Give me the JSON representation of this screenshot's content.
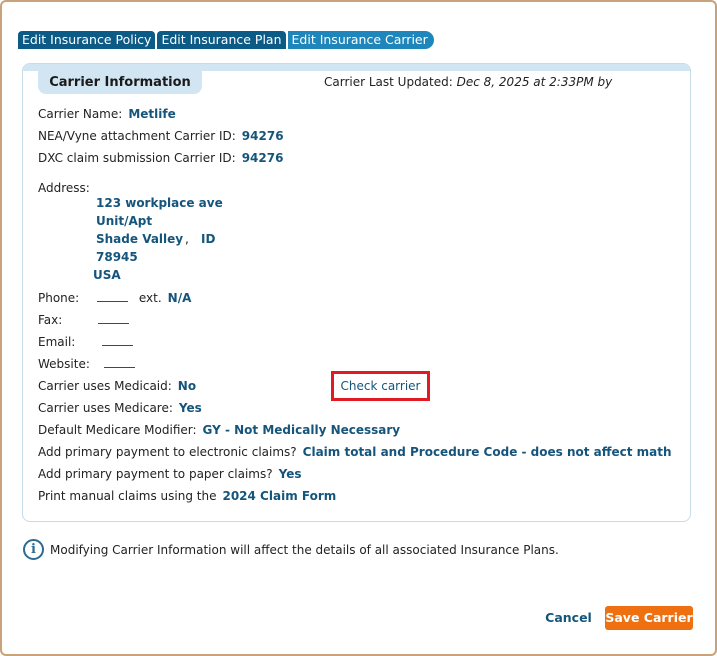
{
  "tabs": [
    {
      "label": "Edit Insurance Policy"
    },
    {
      "label": "Edit Insurance Plan"
    },
    {
      "label": "Edit Insurance Carrier"
    }
  ],
  "section_title": "Carrier Information",
  "last_updated": {
    "label": "Carrier Last Updated:",
    "when": "Dec 8, 2025 at 2:33PM by"
  },
  "fields": {
    "carrier_name": {
      "label": "Carrier Name:",
      "value": "Metlife"
    },
    "nea_id": {
      "label": "NEA/Vyne attachment Carrier ID:",
      "value": "94276"
    },
    "dxc_id": {
      "label": "DXC claim submission Carrier ID:",
      "value": "94276"
    },
    "address_label": "Address:",
    "address": {
      "street": "123 workplace ave",
      "unit": "Unit/Apt",
      "city": "Shade Valley",
      "comma": ",",
      "state": "ID",
      "zip": "78945",
      "country": "USA"
    },
    "phone": {
      "label": "Phone:",
      "ext_label": "ext.",
      "ext_value": "N/A"
    },
    "fax": {
      "label": "Fax:"
    },
    "email": {
      "label": "Email:"
    },
    "website": {
      "label": "Website:"
    },
    "medicaid": {
      "label": "Carrier uses Medicaid:",
      "value": "No"
    },
    "medicare": {
      "label": "Carrier uses Medicare:",
      "value": "Yes"
    },
    "modifier": {
      "label": "Default Medicare Modifier:",
      "value": "GY - Not Medically Necessary"
    },
    "primary_electronic": {
      "label": "Add primary payment to electronic claims?",
      "value": "Claim total and Procedure Code - does not affect math"
    },
    "primary_paper": {
      "label": "Add primary payment to paper claims?",
      "value": "Yes"
    },
    "manual_claims": {
      "label": "Print manual claims using the",
      "value": "2024 Claim Form"
    }
  },
  "check_carrier_label": "Check carrier",
  "info_icon": "i",
  "info_text": "Modifying Carrier Information will affect the details of all associated Insurance Plans.",
  "buttons": {
    "cancel": "Cancel",
    "save": "Save Carrier"
  },
  "colors": {
    "accent": "#15557c",
    "tab": "#0c5a86",
    "tab_active": "#1e86ba",
    "save": "#ef7010",
    "highlight_border": "#e01b24"
  }
}
